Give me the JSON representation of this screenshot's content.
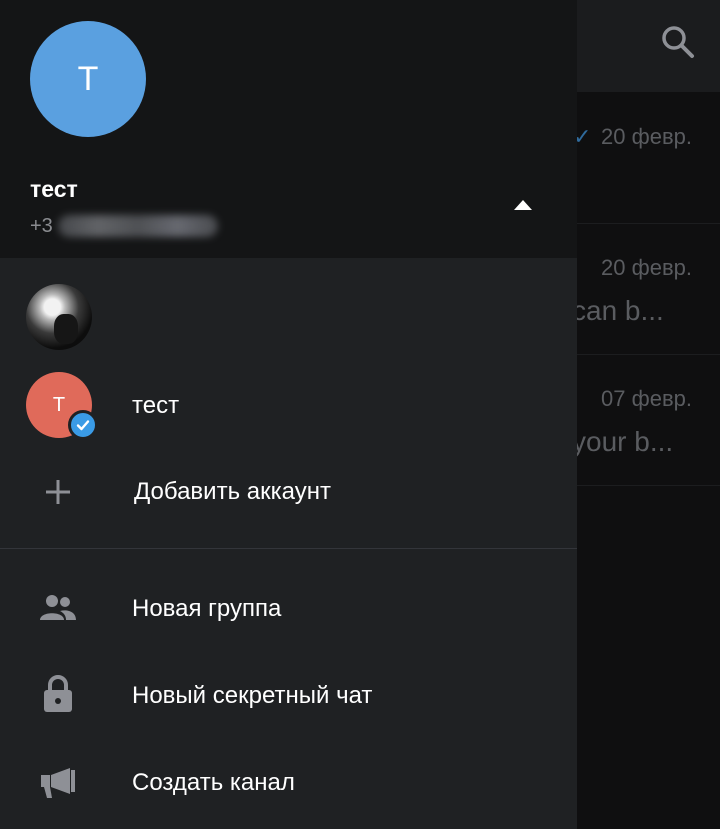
{
  "background": {
    "chats": [
      {
        "date": "20 февр.",
        "snippet": ""
      },
      {
        "date": "20 февр.",
        "snippet": "can b..."
      },
      {
        "date": "07 февр.",
        "snippet": "your b..."
      }
    ]
  },
  "drawer": {
    "header": {
      "avatar_letter": "T",
      "name": "тест",
      "phone_prefix": "+3"
    },
    "accounts": [
      {
        "name": "",
        "avatar": "photo"
      },
      {
        "name": "тест",
        "avatar_letter": "T",
        "active": true
      }
    ],
    "add_account_label": "Добавить аккаунт",
    "menu": [
      {
        "label": "Новая группа",
        "icon": "group-icon"
      },
      {
        "label": "Новый секретный чат",
        "icon": "lock-icon"
      },
      {
        "label": "Создать канал",
        "icon": "megaphone-icon"
      }
    ]
  },
  "colors": {
    "accent": "#5aa0e0",
    "account_avatar": "#e06a5a",
    "verified": "#3a9be6",
    "drawer_bg": "#1f2123",
    "header_bg": "#141516"
  }
}
